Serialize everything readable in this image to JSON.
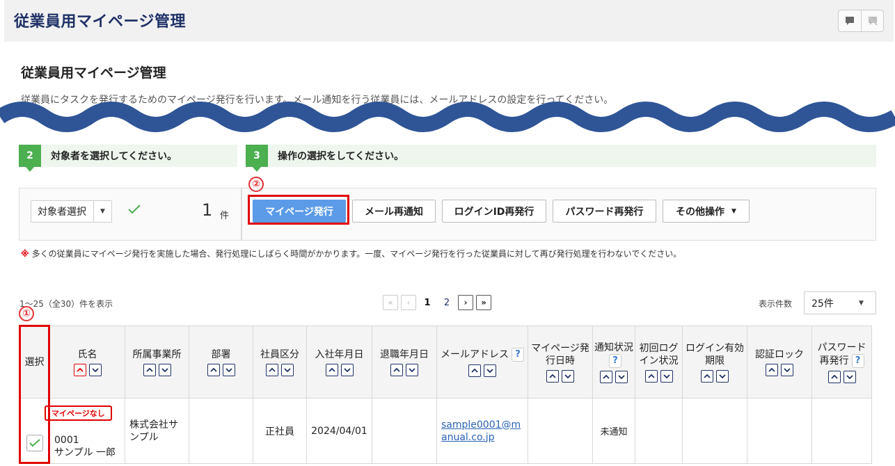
{
  "header": {
    "title": "従業員用マイページ管理",
    "icons": [
      "comment-icon",
      "comment-off-icon"
    ]
  },
  "page": {
    "title": "従業員用マイページ管理",
    "description": "従業員にタスクを発行するためのマイページ発行を行います。メール通知を行う従業員には、メールアドレスの設定を行ってください。"
  },
  "steps": [
    {
      "num": "2",
      "label": "対象者を選択してください。"
    },
    {
      "num": "3",
      "label": "操作の選択をしてください。"
    }
  ],
  "selection": {
    "select_label": "対象者選択",
    "count": "1",
    "count_unit": "件"
  },
  "operations": {
    "issue": "マイページ発行",
    "resend_mail": "メール再通知",
    "reissue_login": "ログインID再発行",
    "reissue_password": "パスワード再発行",
    "other": "その他操作"
  },
  "annotations": {
    "circle1": "①",
    "circle2": "②"
  },
  "note": {
    "mark": "※",
    "text": "多くの従業員にマイページ発行を実施した場合、発行処理にしばらく時間がかかります。一度、マイページ発行を行った従業員に対して再び発行処理を行わないでください。"
  },
  "list": {
    "range_text": "1～25（全30）件を表示",
    "pages": [
      "1",
      "2"
    ],
    "per_page_label": "表示件数",
    "per_page_value": "25件"
  },
  "table": {
    "headers": {
      "select": "選択",
      "name": "氏名",
      "office": "所属事業所",
      "dept": "部署",
      "emp_type": "社員区分",
      "join_date": "入社年月日",
      "leave_date": "退職年月日",
      "email": "メールアドレス",
      "issued_at": "マイページ発行日時",
      "notify": "通知状況",
      "first_login": "初回ログイン状況",
      "login_expiry": "ログイン有効期限",
      "auth_lock": "認証ロック",
      "pw_reissue": "パスワード再発行"
    },
    "rows": [
      {
        "badge": "マイページなし",
        "code": "0001",
        "name": "サンプル 一郎",
        "office": "株式会社サンプル",
        "dept": "",
        "emp_type": "正社員",
        "join_date": "2024/04/01",
        "leave_date": "",
        "email": "sample0001@manual.co.jp",
        "issued_at": "",
        "notify": "未通知",
        "first_login": "",
        "login_expiry": "",
        "auth_lock": "",
        "pw_reissue": ""
      }
    ]
  },
  "colors": {
    "accent": "#1f3167",
    "primary_button": "#5b9be8",
    "step_green": "#4caf50",
    "annotation_red": "#e00000",
    "wave": "#2f5597"
  }
}
